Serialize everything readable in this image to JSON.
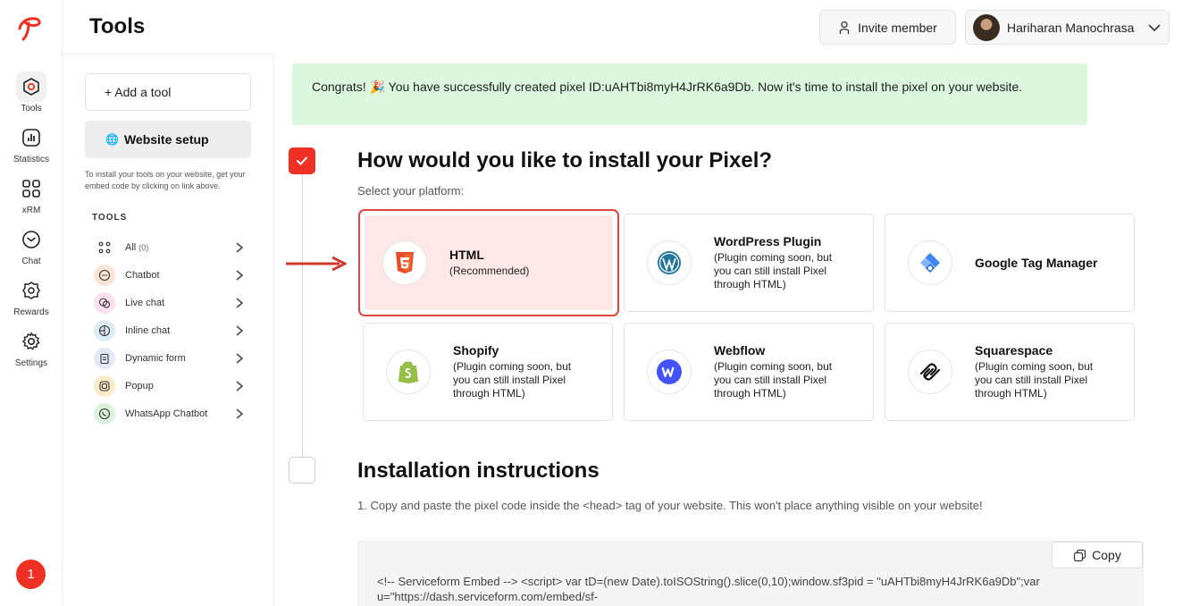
{
  "rail": {
    "items": [
      {
        "label": "Tools",
        "icon": "tools-hexagon-icon"
      },
      {
        "label": "Statistics",
        "icon": "bar-chart-icon"
      },
      {
        "label": "xRM",
        "icon": "grid-icon"
      },
      {
        "label": "Chat",
        "icon": "chat-icon"
      },
      {
        "label": "Rewards",
        "icon": "badge-icon"
      },
      {
        "label": "Settings",
        "icon": "gear-icon"
      }
    ],
    "notification_count": "1"
  },
  "header": {
    "title": "Tools",
    "invite_label": "Invite member",
    "user_name": "Hariharan Manochrasa"
  },
  "tools_panel": {
    "add_tool_label": "+ Add a tool",
    "website_setup_label": "Website setup",
    "setup_hint": "To install your tools on your website, get your embed code by clicking on link above.",
    "section_heading": "TOOLS",
    "items": [
      {
        "label": "All",
        "count": "(0)"
      },
      {
        "label": "Chatbot"
      },
      {
        "label": "Live chat"
      },
      {
        "label": "Inline chat"
      },
      {
        "label": "Dynamic form"
      },
      {
        "label": "Popup"
      },
      {
        "label": "WhatsApp Chatbot"
      }
    ]
  },
  "banner": {
    "text": "Congrats! 🎉 You have successfully created pixel ID:uAHTbi8myH4JrRK6a9Db. Now it's time to install the pixel on your website."
  },
  "step1": {
    "title": "How would you like to install your Pixel?",
    "subtitle": "Select your platform:"
  },
  "platforms": [
    {
      "name": "HTML",
      "desc": "(Recommended)",
      "icon": "html5-icon",
      "selected": true
    },
    {
      "name": "WordPress Plugin",
      "desc": "(Plugin coming soon, but you can still install Pixel through HTML)",
      "icon": "wordpress-icon"
    },
    {
      "name": "Google Tag Manager",
      "desc": "",
      "icon": "google-tag-manager-icon"
    },
    {
      "name": "Shopify",
      "desc": "(Plugin coming soon, but you can still install Pixel through HTML)",
      "icon": "shopify-icon"
    },
    {
      "name": "Webflow",
      "desc": "(Plugin coming soon, but you can still install Pixel through HTML)",
      "icon": "webflow-icon"
    },
    {
      "name": "Squarespace",
      "desc": "(Plugin coming soon, but you can still install Pixel through HTML)",
      "icon": "squarespace-icon"
    }
  ],
  "step2": {
    "title": "Installation instructions",
    "instruction_1": "1. Copy and paste the pixel code inside the <head> tag of your website. This won't place anything visible on your website!"
  },
  "code": {
    "copy_label": "Copy",
    "snippet": "<!-- Serviceform Embed --> <script> var tD=(new Date).toISOString().slice(0,10);window.sf3pid = \"uAHTbi8myH4JrRK6a9Db\";var u=\"https://dash.serviceform.com/embed/sf-"
  },
  "colors": {
    "accent": "#ee3124",
    "banner_bg": "#dbf7dd",
    "selected_bg": "#fde7e7"
  }
}
